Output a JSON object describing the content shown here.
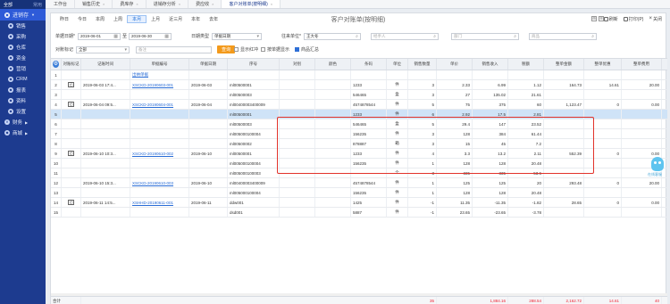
{
  "sidebar": {
    "top_left": "全部",
    "top_right": "常用",
    "module": "进销存",
    "items": [
      "销售",
      "采购",
      "仓库",
      "资金",
      "营销",
      "CRM",
      "报表",
      "资料",
      "设置"
    ],
    "groups": [
      "财务",
      "商城"
    ]
  },
  "tabs": [
    {
      "label": "工作台"
    },
    {
      "label": "销售历史"
    },
    {
      "label": "费库存"
    },
    {
      "label": "进销存分析"
    },
    {
      "label": "费应收"
    },
    {
      "label": "客户对账单(按明细)"
    }
  ],
  "toolbar": {
    "periods": [
      "昨日",
      "今日",
      "本周",
      "上周",
      "本月",
      "上月",
      "近三月",
      "本年",
      "去年"
    ],
    "active_period": "本月",
    "title": "客户对账单(按明细)",
    "refresh": "刷新",
    "print": "打印(P)",
    "close": "关闭",
    "mini_icons": [
      "⊞",
      "☰"
    ]
  },
  "filters": {
    "date_label": "单据日期*",
    "date_from": "2019-06-01",
    "date_to": "2019-06-30",
    "date_type_label": "日期类型",
    "date_type_value": "单据日期",
    "unit_label": "往来单位*",
    "unit_value": "王大冬",
    "person_label": "",
    "person_placeholder": "经手人",
    "dept_placeholder": "部门",
    "goods_placeholder": "商品",
    "flag_label": "对账标记",
    "flag_value": "全部",
    "remark_placeholder": "备注",
    "query_button": "查询",
    "chk_red": "显示红冲",
    "chk_bill": "按单据显示",
    "chk_goods": "商品汇总"
  },
  "table": {
    "headers": [
      "",
      "对账标记",
      "记账时间",
      "单据编号",
      "单据日期",
      "序号",
      "对别",
      "颜色",
      "条码",
      "单位",
      "销售数量",
      "单价",
      "销售收入",
      "税额",
      "整单金额",
      "整单优惠",
      "整单费用",
      ""
    ],
    "rows": [
      {
        "no": "1",
        "flag": "",
        "time": "",
        "bill": "出纳单据",
        "date": "",
        "code": "",
        "barcode": "",
        "unit": "",
        "qty": "",
        "price": "",
        "income": "",
        "tax": "",
        "total": "",
        "discount": "",
        "fee": ""
      },
      {
        "no": "2",
        "flag": "已",
        "time": "2019-06-03 17:4...",
        "bill": "XSCKD-20190603-001",
        "date": "2019-06-03",
        "code": "ml00500001",
        "barcode": "1233",
        "unit": "件",
        "qty": "3",
        "price": "2.33",
        "income": "6.99",
        "tax": "1.12",
        "total": "164.73",
        "discount": "14.61",
        "fee": "20.00"
      },
      {
        "no": "3",
        "flag": "",
        "time": "",
        "bill": "",
        "date": "",
        "code": "ml00500003",
        "barcode": "546465",
        "unit": "盒",
        "qty": "3",
        "price": "27",
        "income": "135.02",
        "tax": "21.61",
        "total": "",
        "discount": "",
        "fee": ""
      },
      {
        "no": "4",
        "flag": "已",
        "time": "2019-06-04 09:5...",
        "bill": "XSCKD-20190604-001",
        "date": "2019-06-04",
        "code": "ml00400003400009",
        "barcode": "4574878544",
        "unit": "件",
        "qty": "5",
        "price": "75",
        "income": "375",
        "tax": "60",
        "total": "1,123.47",
        "discount": "0",
        "fee": "0.00"
      },
      {
        "no": "5",
        "flag": "",
        "time": "",
        "bill": "",
        "date": "",
        "code": "ml00500001",
        "barcode": "1233",
        "unit": "件",
        "qty": "6",
        "price": "2.92",
        "income": "17.5",
        "tax": "2.81",
        "total": "",
        "discount": "",
        "fee": ""
      },
      {
        "no": "6",
        "flag": "",
        "time": "",
        "bill": "",
        "date": "",
        "code": "ml00500003",
        "barcode": "546465",
        "unit": "盒",
        "qty": "5",
        "price": "29.4",
        "income": "147",
        "tax": "23.52",
        "total": "",
        "discount": "",
        "fee": ""
      },
      {
        "no": "7",
        "flag": "",
        "time": "",
        "bill": "",
        "date": "",
        "code": "ml005000100004",
        "barcode": "156235",
        "unit": "件",
        "qty": "3",
        "price": "128",
        "income": "384",
        "tax": "61.44",
        "total": "",
        "discount": "",
        "fee": ""
      },
      {
        "no": "8",
        "flag": "",
        "time": "",
        "bill": "",
        "date": "",
        "code": "ml00500002",
        "barcode": "878887",
        "unit": "箱",
        "qty": "3",
        "price": "15",
        "income": "45",
        "tax": "7.2",
        "total": "",
        "discount": "",
        "fee": ""
      },
      {
        "no": "9",
        "flag": "已",
        "time": "2019-06-10 10:3...",
        "bill": "XSCKD-20190610-002",
        "date": "2019-06-10",
        "code": "ml00500001",
        "barcode": "1233",
        "unit": "件",
        "qty": "4",
        "price": "3.3",
        "income": "13.2",
        "tax": "2.11",
        "total": "552.39",
        "discount": "0",
        "fee": "0.00"
      },
      {
        "no": "10",
        "flag": "",
        "time": "",
        "bill": "",
        "date": "",
        "code": "ml005000100004",
        "barcode": "156235",
        "unit": "件",
        "qty": "1",
        "price": "128",
        "income": "128",
        "tax": "20.48",
        "total": "",
        "discount": "",
        "fee": ""
      },
      {
        "no": "11",
        "flag": "",
        "time": "",
        "bill": "",
        "date": "",
        "code": "ml005000100003",
        "barcode": "",
        "unit": "个",
        "qty": "3",
        "price": "335",
        "income": "335",
        "tax": "53.6",
        "total": "",
        "discount": "",
        "fee": ""
      },
      {
        "no": "12",
        "flag": "",
        "time": "2019-06-10 15:3...",
        "bill": "XSCKD-20190610-003",
        "date": "2019-06-10",
        "code": "ml00400003400009",
        "barcode": "4574878544",
        "unit": "件",
        "qty": "1",
        "price": "125",
        "income": "125",
        "tax": "20",
        "total": "293.48",
        "discount": "0",
        "fee": "20.00"
      },
      {
        "no": "13",
        "flag": "",
        "time": "",
        "bill": "",
        "date": "",
        "code": "ml005000100004",
        "barcode": "156235",
        "unit": "件",
        "qty": "1",
        "price": "128",
        "income": "128",
        "tax": "20.48",
        "total": "",
        "discount": "",
        "fee": ""
      },
      {
        "no": "14",
        "flag": "已",
        "time": "2019-06-11 14:5...",
        "bill": "XSHHD-20190611-001",
        "date": "2019-06-11",
        "code": "ddw001",
        "barcode": "1425",
        "unit": "件",
        "qty": "-1",
        "price": "11.35",
        "income": "-11.35",
        "tax": "-1.82",
        "total": "28.65",
        "discount": "0",
        "fee": "0.00"
      },
      {
        "no": "15",
        "flag": "",
        "time": "",
        "bill": "",
        "date": "",
        "code": "dsd001",
        "barcode": "5887",
        "unit": "件",
        "qty": "-1",
        "price": "23.65",
        "income": "-23.65",
        "tax": "-3.78",
        "total": "",
        "discount": "",
        "fee": ""
      }
    ],
    "footer": {
      "label": "合计",
      "qty": "35",
      "income": "1,884.16",
      "tax": "288.54",
      "total": "2,162.72",
      "discount": "14.61",
      "fee": "40"
    }
  },
  "mascot_label": "在线客服",
  "colors": {
    "sidebar": "#1d3b8f",
    "accent": "#2e5bd8",
    "query": "#f39a1c",
    "highlight": "#e2332b"
  }
}
